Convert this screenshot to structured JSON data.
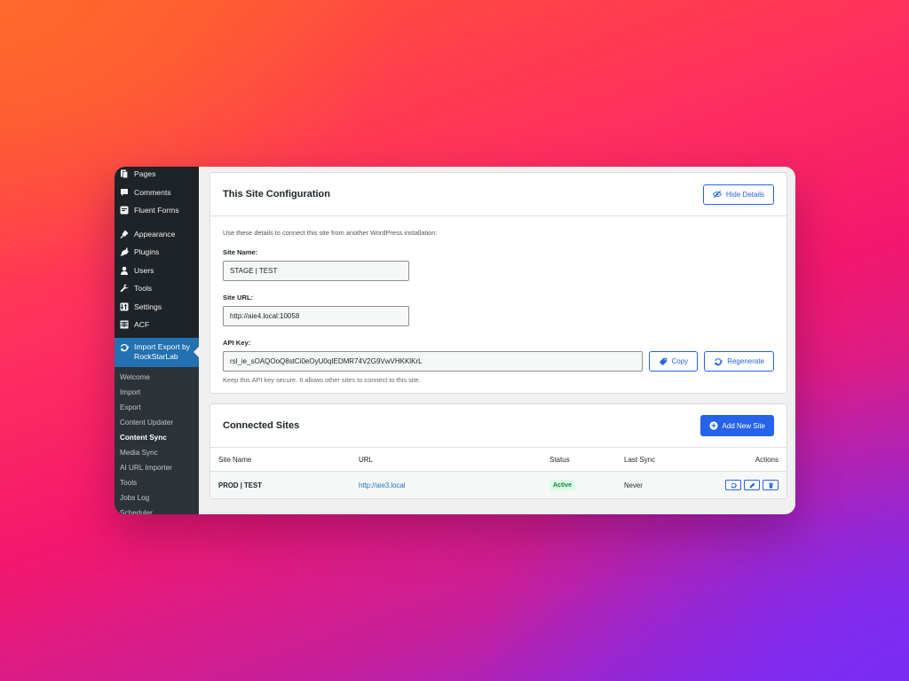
{
  "sidebar": {
    "menu": [
      {
        "label": "Pages",
        "icon": "pages-icon"
      },
      {
        "label": "Comments",
        "icon": "comments-icon"
      },
      {
        "label": "Fluent Forms",
        "icon": "fluent-forms-icon"
      },
      {
        "label": "Appearance",
        "icon": "appearance-icon"
      },
      {
        "label": "Plugins",
        "icon": "plugins-icon"
      },
      {
        "label": "Users",
        "icon": "users-icon"
      },
      {
        "label": "Tools",
        "icon": "tools-icon"
      },
      {
        "label": "Settings",
        "icon": "settings-icon"
      },
      {
        "label": "ACF",
        "icon": "acf-icon"
      }
    ],
    "active": {
      "label_line1": "Import Export by",
      "label_line2": "RockStarLab",
      "icon": "sync-icon"
    },
    "submenu": [
      "Welcome",
      "Import",
      "Export",
      "Content Updater",
      "Content Sync",
      "Media Sync",
      "AI URL Importer",
      "Tools",
      "Jobs Log",
      "Scheduler"
    ],
    "current_submenu": "Content Sync"
  },
  "config": {
    "title": "This Site Configuration",
    "hide_button": "Hide Details",
    "intro": "Use these details to connect this site from another WordPress installation:",
    "site_name_label": "Site Name:",
    "site_name_value": "STAGE | TEST",
    "site_url_label": "Site URL:",
    "site_url_value": "http://aie4.local:10058",
    "api_key_label": "API Key:",
    "api_key_value": "rsl_ie_sOAQOoQ8stCi0eOyU0qIEDMR74V2G9VwVHKKlKrL",
    "copy_button": "Copy",
    "regenerate_button": "Regenerate",
    "hint": "Keep this API key secure. It allows other sites to connect to this site."
  },
  "connected": {
    "title": "Connected Sites",
    "add_button": "Add New Site",
    "columns": {
      "name": "Site Name",
      "url": "URL",
      "status": "Status",
      "last_sync": "Last Sync",
      "actions": "Actions"
    },
    "rows": [
      {
        "name": "PROD | TEST",
        "url": "http://aie3.local",
        "status": "Active",
        "last_sync": "Never"
      }
    ]
  },
  "colors": {
    "accent": "#2563eb",
    "sidebar_bg": "#1d2327",
    "active_menu": "#2271b1",
    "status_active_bg": "#dcfce7"
  }
}
